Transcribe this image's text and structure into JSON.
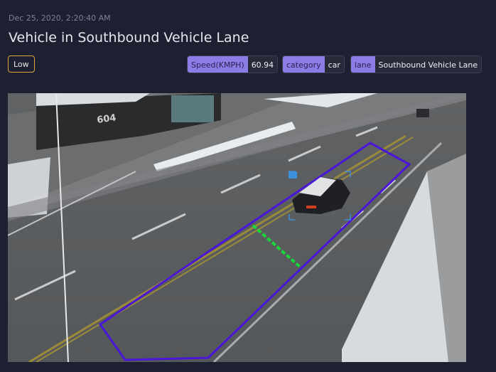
{
  "event": {
    "timestamp": "Dec 25, 2020, 2:20:40 AM",
    "title": "Vehicle in Southbound Vehicle Lane",
    "severity": "Low"
  },
  "tags": [
    {
      "key": "Speed(KMPH)",
      "value": "60.94"
    },
    {
      "key": "category",
      "value": "car"
    },
    {
      "key": "lane",
      "value": "Southbound Vehicle Lane"
    }
  ],
  "camera": {
    "building_number": "604"
  },
  "colors": {
    "background": "#1c2030",
    "tag_key": "#8b7ce6",
    "tag_value": "#262a39",
    "severity_border": "#e0a43a",
    "lane_polygon": "#4a16d8",
    "speed_line": "#19d63a",
    "vehicle_box": "#3c8fd8"
  }
}
